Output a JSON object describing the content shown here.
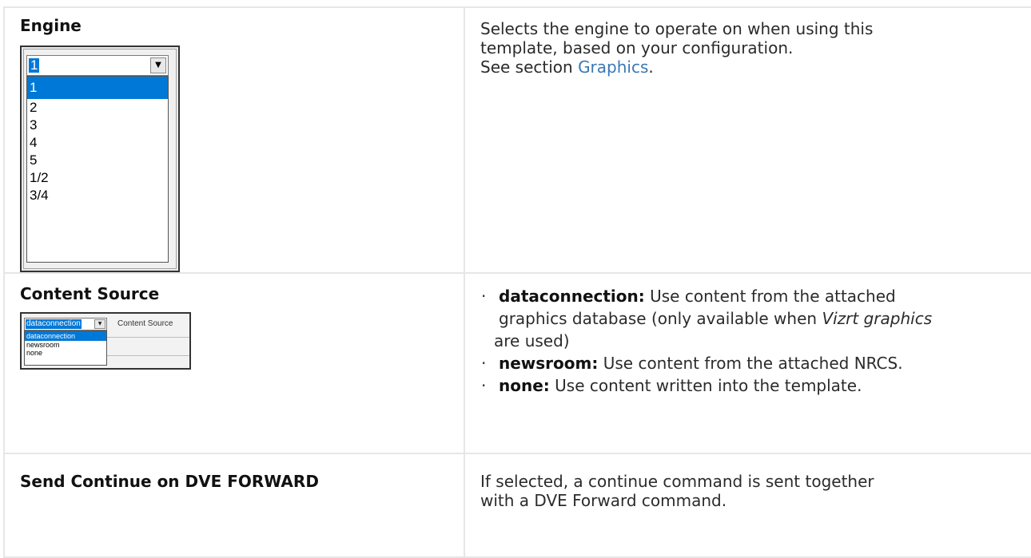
{
  "rows": [
    {
      "label": "Engine",
      "description_lines": [
        "Selects the engine to operate on when using this",
        "template, based on your configuration."
      ],
      "see_prefix": "See section ",
      "see_link": "Graphics",
      "see_suffix": ".",
      "widget": {
        "selected_value": "1",
        "options": [
          "1",
          "2",
          "3",
          "4",
          "5",
          "1/2",
          "3/4"
        ]
      }
    },
    {
      "label": "Content Source",
      "widget": {
        "selected_value": "dataconnection",
        "field_label": "Content Source",
        "options": [
          "dataconnection",
          "newsroom",
          "none"
        ]
      },
      "bullets": [
        {
          "term": "dataconnection:",
          "text_a": " Use content from the attached",
          "text_b": "graphics database (only available when ",
          "italic": "Vizrt graphics",
          "text_c": " are used)"
        },
        {
          "term": "newsroom:",
          "text": " Use content from the attached NRCS."
        },
        {
          "term": "none:",
          "text": " Use content written into the template."
        }
      ]
    },
    {
      "label": "Send Continue on DVE FORWARD",
      "description_lines": [
        "If selected, a continue command is sent together",
        "with a DVE Forward command."
      ]
    }
  ],
  "colors": {
    "link": "#3a78b5",
    "selection": "#0078d7",
    "table_border": "#e6e6e6"
  },
  "icons": {
    "bullet": "·",
    "dropdown_arrow": "▼"
  }
}
